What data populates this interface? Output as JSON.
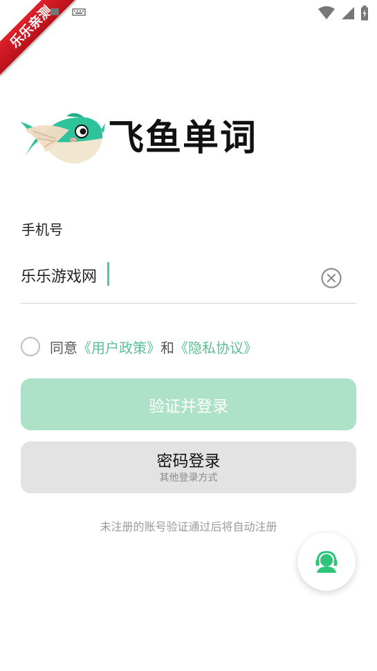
{
  "ribbon": {
    "text": "乐乐亲测"
  },
  "status_bar": {
    "left_icons": [
      "image-icon",
      "keyboard-icon"
    ],
    "right_icons": [
      "wifi-icon",
      "signal-icon",
      "battery-icon"
    ]
  },
  "app": {
    "title": "飞鱼单词"
  },
  "phone": {
    "label": "手机号",
    "value": "乐乐游戏网"
  },
  "agreement": {
    "prefix": "同意",
    "user_policy": "《用户政策》",
    "conjunction": "和",
    "privacy": "《隐私协议》"
  },
  "buttons": {
    "verify_login": "验证并登录",
    "password_login": "密码登录",
    "other_methods": "其他登录方式"
  },
  "note": "未注册的账号验证通过后将自动注册",
  "colors": {
    "accent": "#5dbf95",
    "primary_disabled": "#ade2c9",
    "secondary_button": "#e3e3e3",
    "ribbon": "#d41a22",
    "support": "#2ec57a"
  }
}
